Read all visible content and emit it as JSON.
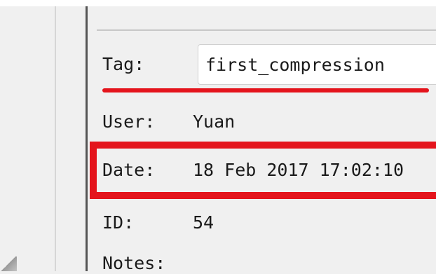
{
  "fields": {
    "tag": {
      "label": "Tag:",
      "value": "first_compression"
    },
    "user": {
      "label": "User:",
      "value": "Yuan"
    },
    "date": {
      "label": "Date:",
      "value": "18 Feb 2017 17:02:10"
    },
    "id": {
      "label": "ID:",
      "value": "54"
    },
    "notes": {
      "label": "Notes:"
    }
  },
  "colors": {
    "annotation": "#e4141c",
    "panel_background": "#f0f0f0"
  }
}
